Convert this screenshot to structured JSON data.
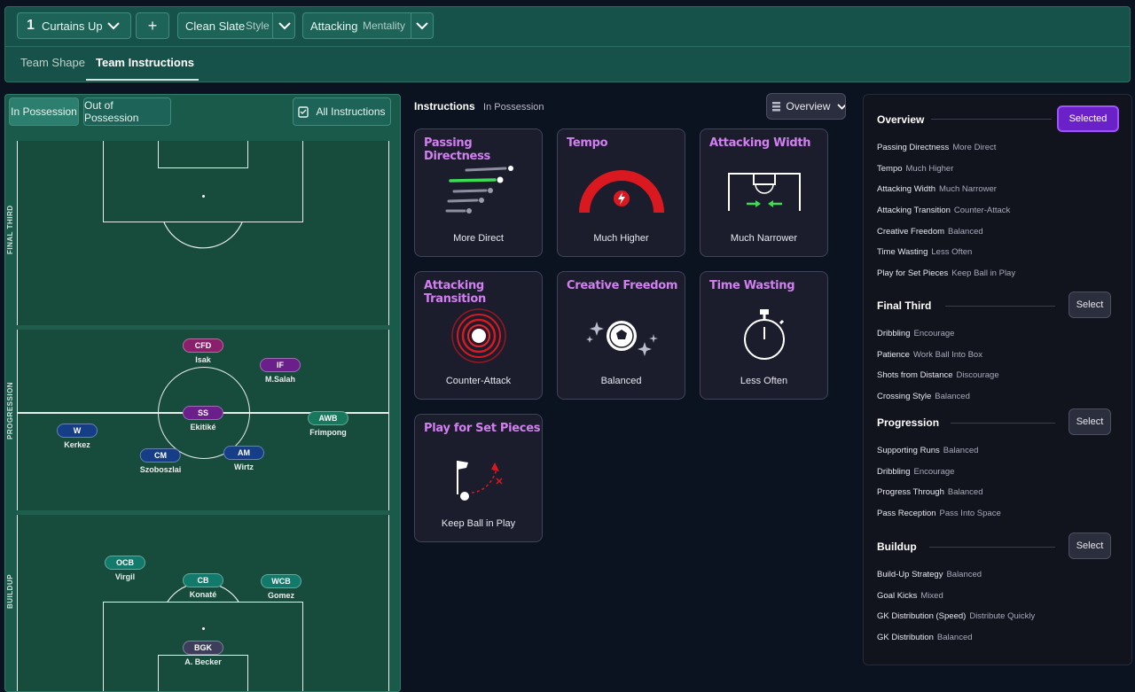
{
  "topbar": {
    "tactic_number": "1",
    "tactic_name": "Curtains Up",
    "add_label": "+",
    "style_value": "Clean Slate",
    "style_label": "Style",
    "mentality_value": "Attacking",
    "mentality_label": "Mentality"
  },
  "tabs": [
    {
      "label": "Team Shape"
    },
    {
      "label": "Team Instructions"
    }
  ],
  "pitch_panel": {
    "toggles": [
      "In Possession",
      "Out of Possession"
    ],
    "all_instructions": "All Instructions",
    "zones": [
      "FINAL THIRD",
      "PROGRESSION",
      "BUILDUP"
    ]
  },
  "players": [
    {
      "role": "CFD",
      "name": "Isak",
      "color": "#8a1f6b"
    },
    {
      "role": "IF",
      "name": "M.Salah",
      "color": "#6a1f8a"
    },
    {
      "role": "SS",
      "name": "Ekitiké",
      "color": "#6a1f8a"
    },
    {
      "role": "AWB",
      "name": "Frimpong",
      "color": "#16785c"
    },
    {
      "role": "W",
      "name": "Kerkez",
      "color": "#163e86"
    },
    {
      "role": "CM",
      "name": "Szoboszlai",
      "color": "#163e86"
    },
    {
      "role": "AM",
      "name": "Wirtz",
      "color": "#163e86"
    },
    {
      "role": "OCB",
      "name": "Virgil",
      "color": "#127a6a"
    },
    {
      "role": "CB",
      "name": "Konaté",
      "color": "#127a6a"
    },
    {
      "role": "WCB",
      "name": "Gomez",
      "color": "#127a6a"
    },
    {
      "role": "BGK",
      "name": "A. Becker",
      "color": "#3d3e5c"
    }
  ],
  "instructions": {
    "title": "Instructions",
    "subtitle": "In Possession",
    "view_dropdown": "Overview",
    "cards": [
      {
        "title": "Passing Directness",
        "value": "More Direct"
      },
      {
        "title": "Tempo",
        "value": "Much Higher"
      },
      {
        "title": "Attacking Width",
        "value": "Much Narrower"
      },
      {
        "title": "Attacking Transition",
        "value": "Counter-Attack"
      },
      {
        "title": "Creative Freedom",
        "value": "Balanced"
      },
      {
        "title": "Time Wasting",
        "value": "Less Often"
      },
      {
        "title": "Play for Set Pieces",
        "value": "Keep Ball in Play"
      }
    ]
  },
  "overview_panel": {
    "sections": [
      {
        "title": "Overview",
        "button": "Selected",
        "items": [
          {
            "k": "Passing Directness",
            "v": "More Direct"
          },
          {
            "k": "Tempo",
            "v": "Much Higher"
          },
          {
            "k": "Attacking Width",
            "v": "Much Narrower"
          },
          {
            "k": "Attacking Transition",
            "v": "Counter-Attack"
          },
          {
            "k": "Creative Freedom",
            "v": "Balanced"
          },
          {
            "k": "Time Wasting",
            "v": "Less Often"
          },
          {
            "k": "Play for Set Pieces",
            "v": "Keep Ball in Play"
          }
        ]
      },
      {
        "title": "Final Third",
        "button": "Select",
        "items": [
          {
            "k": "Dribbling",
            "v": "Encourage"
          },
          {
            "k": "Patience",
            "v": "Work Ball Into Box"
          },
          {
            "k": "Shots from Distance",
            "v": "Discourage"
          },
          {
            "k": "Crossing Style",
            "v": "Balanced"
          }
        ]
      },
      {
        "title": "Progression",
        "button": "Select",
        "items": [
          {
            "k": "Supporting Runs",
            "v": "Balanced"
          },
          {
            "k": "Dribbling",
            "v": "Encourage"
          },
          {
            "k": "Progress Through",
            "v": "Balanced"
          },
          {
            "k": "Pass Reception",
            "v": "Pass Into Space"
          }
        ]
      },
      {
        "title": "Buildup",
        "button": "Select",
        "items": [
          {
            "k": "Build-Up Strategy",
            "v": "Balanced"
          },
          {
            "k": "Goal Kicks",
            "v": "Mixed"
          },
          {
            "k": "GK Distribution (Speed)",
            "v": "Distribute Quickly"
          },
          {
            "k": "GK Distribution",
            "v": "Balanced"
          }
        ]
      }
    ]
  }
}
